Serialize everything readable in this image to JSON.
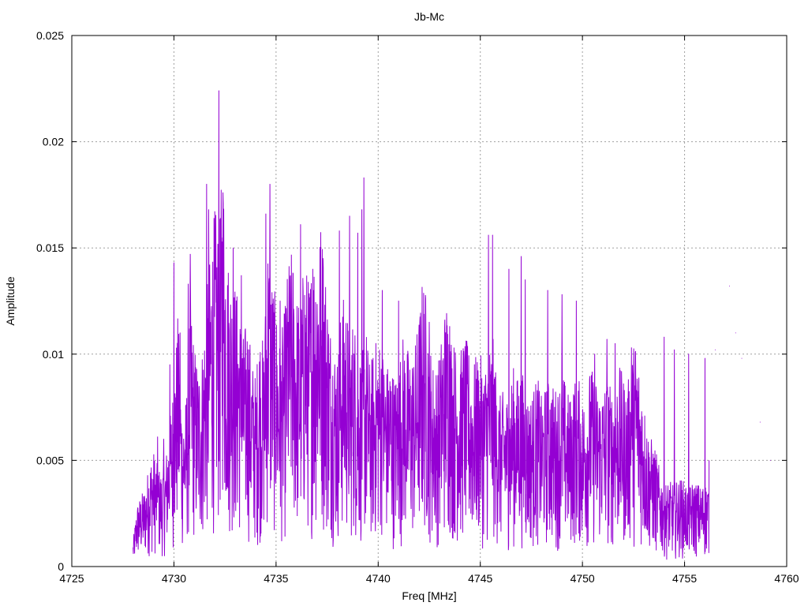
{
  "chart_data": {
    "type": "line",
    "title": "Jb-Mc",
    "xlabel": "Freq [MHz]",
    "ylabel": "Amplitude",
    "xlim": [
      4725,
      4760
    ],
    "ylim": [
      0,
      0.025
    ],
    "grid": true,
    "x_ticks": [
      "4725",
      "4730",
      "4735",
      "4740",
      "4745",
      "4750",
      "4755",
      "4760"
    ],
    "y_ticks": [
      "0",
      "0.005",
      "0.01",
      "0.015",
      "0.02",
      "0.025"
    ],
    "series": [
      {
        "color": "#9400d3",
        "x_start": 4728.0,
        "x_step": 0.2,
        "envelope": [
          0.0012,
          0.003,
          0.0034,
          0.0038,
          0.005,
          0.0055,
          0.0048,
          0.0045,
          0.0052,
          0.007,
          0.009,
          0.012,
          0.0075,
          0.008,
          0.013,
          0.0105,
          0.0095,
          0.0105,
          0.013,
          0.015,
          0.017,
          0.016,
          0.0195,
          0.015,
          0.014,
          0.0135,
          0.0125,
          0.011,
          0.012,
          0.01,
          0.009,
          0.0115,
          0.0105,
          0.016,
          0.014,
          0.0125,
          0.0105,
          0.012,
          0.0145,
          0.015,
          0.013,
          0.0125,
          0.015,
          0.0135,
          0.015,
          0.016,
          0.0165,
          0.0145,
          0.012,
          0.011,
          0.01,
          0.0125,
          0.013,
          0.011,
          0.012,
          0.0105,
          0.01,
          0.0115,
          0.0095,
          0.0105,
          0.011,
          0.0105,
          0.0095,
          0.01,
          0.009,
          0.0095,
          0.011,
          0.0105,
          0.01,
          0.0105,
          0.012,
          0.014,
          0.0125,
          0.01,
          0.0095,
          0.01,
          0.012,
          0.013,
          0.011,
          0.0105,
          0.01,
          0.011,
          0.0105,
          0.0095,
          0.01,
          0.01,
          0.0095,
          0.0105,
          0.011,
          0.009,
          0.008,
          0.0085,
          0.008,
          0.0095,
          0.009,
          0.0095,
          0.0085,
          0.008,
          0.0085,
          0.009,
          0.008,
          0.0085,
          0.009,
          0.0085,
          0.0085,
          0.0095,
          0.0085,
          0.008,
          0.009,
          0.009,
          0.008,
          0.0085,
          0.0095,
          0.009,
          0.0085,
          0.0085,
          0.009,
          0.0085,
          0.0085,
          0.0095,
          0.009,
          0.0085,
          0.01,
          0.011,
          0.0095,
          0.008,
          0.0065,
          0.006,
          0.0055,
          0.0045,
          0.004,
          0.004,
          0.004,
          0.004,
          0.0042,
          0.004,
          0.0038,
          0.004,
          0.004,
          0.0038,
          0.004,
          0.004
        ],
        "peaks": [
          [
            4729.2,
            0.0061
          ],
          [
            4729.5,
            0.006
          ],
          [
            4729.8,
            0.0095
          ],
          [
            4730.0,
            0.0143
          ],
          [
            4730.3,
            0.011
          ],
          [
            4730.7,
            0.0133
          ],
          [
            4730.8,
            0.0147
          ],
          [
            4731.6,
            0.018
          ],
          [
            4731.7,
            0.0168
          ],
          [
            4732.2,
            0.0224
          ],
          [
            4732.4,
            0.0176
          ],
          [
            4732.9,
            0.015
          ],
          [
            4733.3,
            0.0137
          ],
          [
            4734.7,
            0.018
          ],
          [
            4734.5,
            0.0166
          ],
          [
            4735.2,
            0.0125
          ],
          [
            4736.2,
            0.0161
          ],
          [
            4736.8,
            0.014
          ],
          [
            4737.3,
            0.0145
          ],
          [
            4738.1,
            0.0158
          ],
          [
            4738.6,
            0.0165
          ],
          [
            4739.0,
            0.0157
          ],
          [
            4739.3,
            0.0183
          ],
          [
            4739.2,
            0.0168
          ],
          [
            4740.2,
            0.013
          ],
          [
            4741.0,
            0.0125
          ],
          [
            4742.5,
            0.0115
          ],
          [
            4743.5,
            0.0113
          ],
          [
            4745.4,
            0.0156
          ],
          [
            4745.6,
            0.0156
          ],
          [
            4746.4,
            0.014
          ],
          [
            4747.0,
            0.0146
          ],
          [
            4747.2,
            0.0135
          ],
          [
            4748.3,
            0.013
          ],
          [
            4749.0,
            0.0128
          ],
          [
            4749.7,
            0.0125
          ],
          [
            4750.6,
            0.01
          ],
          [
            4751.2,
            0.0107
          ],
          [
            4751.6,
            0.0105
          ],
          [
            4752.4,
            0.0103
          ],
          [
            4754.0,
            0.0108
          ],
          [
            4754.5,
            0.0102
          ],
          [
            4755.2,
            0.01
          ],
          [
            4756.0,
            0.0098
          ],
          [
            4756.5,
            0.0102
          ],
          [
            4757.2,
            0.0132
          ],
          [
            4757.5,
            0.011
          ],
          [
            4757.8,
            0.0098
          ],
          [
            4758.7,
            0.0068
          ],
          [
            4759.2,
            0.005
          ]
        ]
      }
    ]
  }
}
